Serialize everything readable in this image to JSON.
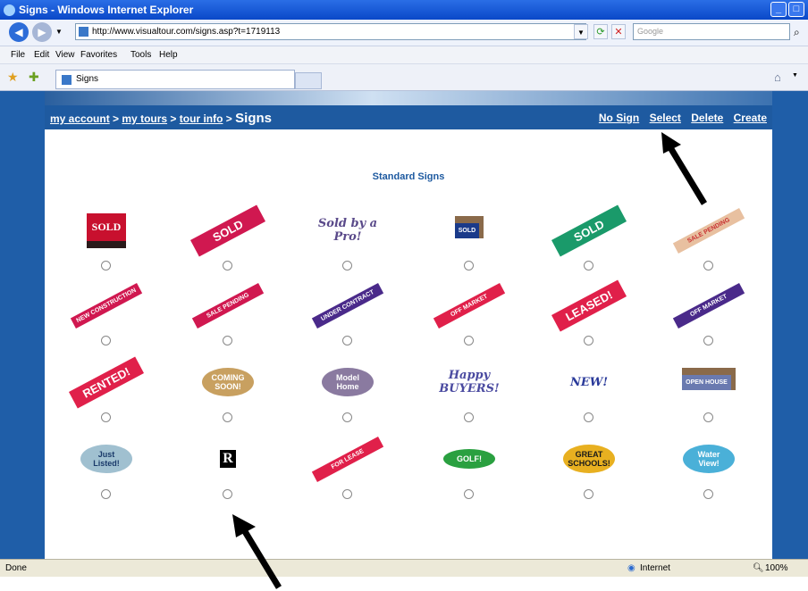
{
  "window": {
    "title": "Signs - Windows Internet Explorer"
  },
  "address": {
    "url": "http://www.visualtour.com/signs.asp?t=1719113",
    "search_placeholder": "Google"
  },
  "menu": [
    "File",
    "Edit",
    "View",
    "Favorites",
    "Tools",
    "Help"
  ],
  "tab": {
    "label": "Signs"
  },
  "breadcrumb": {
    "my_account": "my account",
    "my_tours": "my tours",
    "tour_info": "tour info",
    "sep": ">",
    "current": "Signs"
  },
  "actions": {
    "no_sign": "No Sign",
    "select": "Select",
    "delete": "Delete",
    "create": "Create"
  },
  "section_title": "Standard Signs",
  "signs": [
    {
      "text": "SOLD",
      "style": "board",
      "bg": "#c8102e",
      "fg": "#ffffff"
    },
    {
      "text": "SOLD",
      "style": "ribbon",
      "bg": "#d01850",
      "fg": "#ffffff"
    },
    {
      "text": "Sold by a Pro!",
      "style": "script",
      "bg": "#ffffff",
      "fg": "#5a4a8a"
    },
    {
      "text": "SOLD",
      "style": "post",
      "bg": "#1a3a8a",
      "fg": "#ffffff"
    },
    {
      "text": "SOLD",
      "style": "ribbon",
      "bg": "#1a9a6a",
      "fg": "#ffffff"
    },
    {
      "text": "SALE PENDING",
      "style": "ribbon",
      "bg": "#e8c0a0",
      "fg": "#c83030"
    },
    {
      "text": "NEW CONSTRUCTION",
      "style": "ribbon",
      "bg": "#d01850",
      "fg": "#ffffff"
    },
    {
      "text": "SALE PENDING",
      "style": "ribbon",
      "bg": "#d01850",
      "fg": "#ffffff"
    },
    {
      "text": "UNDER CONTRACT",
      "style": "ribbon",
      "bg": "#4a2a8a",
      "fg": "#ffffff"
    },
    {
      "text": "OFF MARKET",
      "style": "ribbon",
      "bg": "#e0204a",
      "fg": "#ffffff"
    },
    {
      "text": "LEASED!",
      "style": "ribbon",
      "bg": "#e0204a",
      "fg": "#ffffff"
    },
    {
      "text": "OFF MARKET",
      "style": "ribbon",
      "bg": "#4a2a8a",
      "fg": "#ffffff"
    },
    {
      "text": "RENTED!",
      "style": "ribbon",
      "bg": "#e0204a",
      "fg": "#ffffff"
    },
    {
      "text": "COMING SOON!",
      "style": "oval",
      "bg": "#c8a060",
      "fg": "#ffffff"
    },
    {
      "text": "Model Home",
      "style": "oval",
      "bg": "#8a7aa0",
      "fg": "#ffffff"
    },
    {
      "text": "Happy BUYERS!",
      "style": "script",
      "bg": "#ffffff",
      "fg": "#4a4aa0"
    },
    {
      "text": "NEW!",
      "style": "script",
      "bg": "#ffffff",
      "fg": "#2a3a9a"
    },
    {
      "text": "OPEN HOUSE",
      "style": "post",
      "bg": "#6a7ab0",
      "fg": "#ffffff"
    },
    {
      "text": "Just Listed!",
      "style": "oval",
      "bg": "#a0c0d0",
      "fg": "#1a3a6a"
    },
    {
      "text": "R",
      "style": "realtor",
      "bg": "#000000",
      "fg": "#ffffff"
    },
    {
      "text": "FOR LEASE",
      "style": "ribbon",
      "bg": "#e0204a",
      "fg": "#ffffff"
    },
    {
      "text": "GOLF!",
      "style": "oval",
      "bg": "#2aa040",
      "fg": "#ffffff"
    },
    {
      "text": "GREAT SCHOOLS!",
      "style": "oval",
      "bg": "#e8b020",
      "fg": "#1a1a1a"
    },
    {
      "text": "Water View!",
      "style": "oval",
      "bg": "#4ab0d8",
      "fg": "#ffffff"
    }
  ],
  "status": {
    "left": "Done",
    "zone": "Internet",
    "zoom": "100%"
  },
  "colors": {
    "nav_blue": "#1e5aa0",
    "frame_blue": "#1f5ea8",
    "heading_blue": "#1e5aa0"
  }
}
